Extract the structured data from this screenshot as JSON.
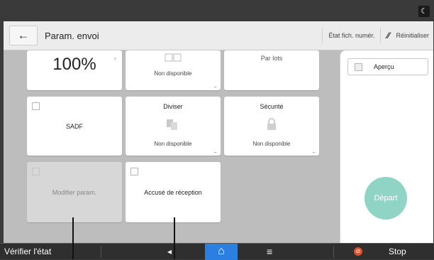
{
  "header": {
    "back_icon": "←",
    "title": "Param. envoi",
    "file_status_label": "État fich. numér.",
    "reset_icon": "⁄⁄",
    "reset_label": "Réinitialiser"
  },
  "topbar": {
    "night_icon": "☾"
  },
  "tiles": {
    "scale": {
      "value": "100%",
      "arrow": "›"
    },
    "unavailable_top": {
      "sub": "Non disponible",
      "more": "..."
    },
    "batch": {
      "label": "Par lots"
    },
    "sadf": {
      "label": "SADF"
    },
    "split": {
      "label": "Diviser",
      "sub": "Non disponible",
      "more": "..."
    },
    "security": {
      "label": "Sécurité",
      "sub": "Non disponible",
      "more": "..."
    },
    "modify": {
      "label": "Modifier param."
    },
    "receipt": {
      "label": "Accusé de réception"
    }
  },
  "right_panel": {
    "preview_label": "Aperçu",
    "start_label": "Départ"
  },
  "bottombar": {
    "check_status": "Vérifier l'état",
    "back_icon": "◂",
    "home_icon": "⌂",
    "menu_icon": "≡",
    "stop_icon": "⊘",
    "stop_label": "Stop"
  }
}
